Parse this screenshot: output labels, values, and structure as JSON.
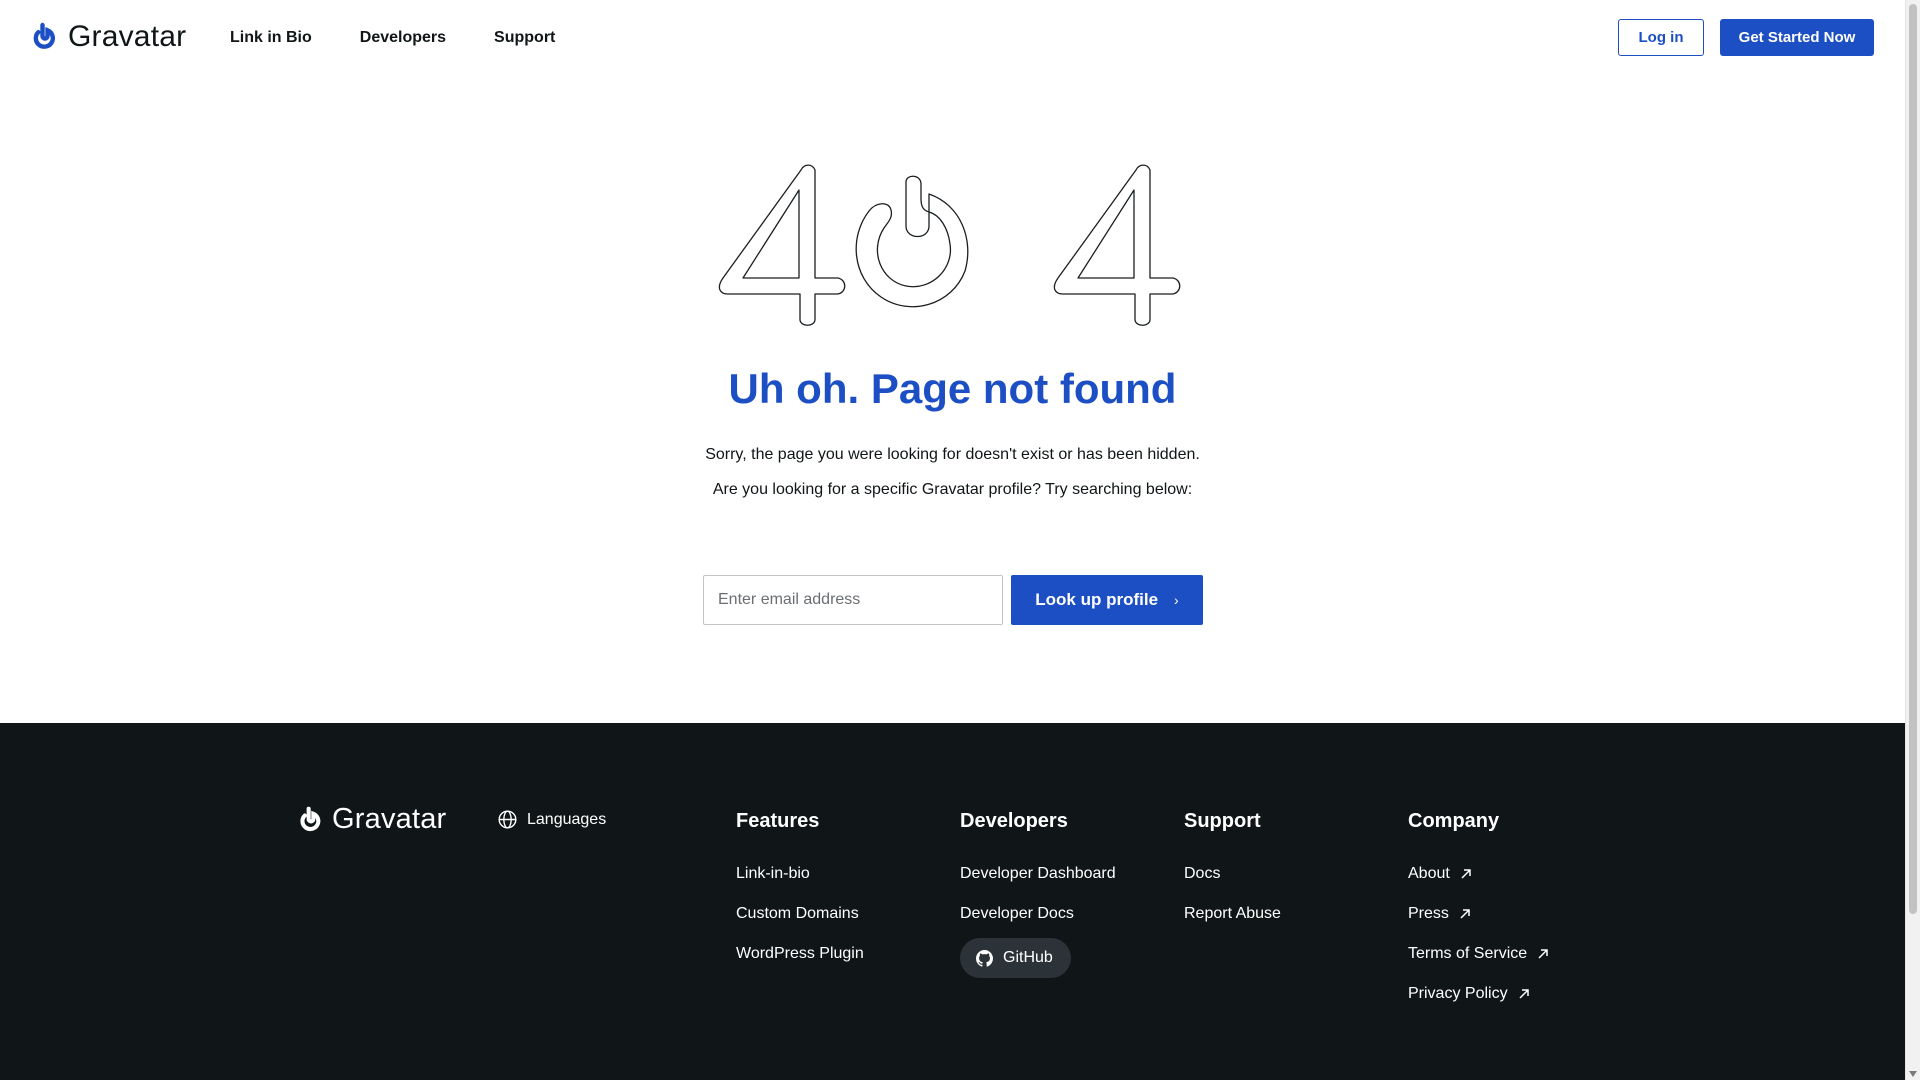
{
  "header": {
    "logo_text": "Gravatar",
    "nav": [
      "Link in Bio",
      "Developers",
      "Support"
    ],
    "login_label": "Log in",
    "start_label": "Get Started Now"
  },
  "hero": {
    "title": "Uh oh. Page not found",
    "desc1": "Sorry, the page you were looking for doesn't exist or has been hidden.",
    "desc2": "Are you looking for a specific Gravatar profile? Try searching below:",
    "search_placeholder": "Enter email address",
    "search_value": "",
    "lookup_label": "Look up profile",
    "lookup_chevron": "›"
  },
  "footer": {
    "logo_text": "Gravatar",
    "languages_label": "Languages",
    "features": {
      "heading": "Features",
      "links": [
        "Link-in-bio",
        "Custom Domains",
        "WordPress Plugin"
      ]
    },
    "developers": {
      "heading": "Developers",
      "links": [
        "Developer Dashboard",
        "Developer Docs"
      ],
      "github_label": "GitHub"
    },
    "support": {
      "heading": "Support",
      "links": [
        "Docs",
        "Report Abuse"
      ]
    },
    "company": {
      "heading": "Company",
      "links": [
        "About",
        "Press",
        "Terms of Service",
        "Privacy Policy"
      ]
    }
  },
  "colors": {
    "brand_blue": "#1d4fc4",
    "footer_bg": "#101517",
    "text": "#101517"
  },
  "icons": {
    "logo": "gravatar-power-icon",
    "languages": "globe-icon",
    "github": "github-icon",
    "external": "arrow-up-right-icon"
  }
}
